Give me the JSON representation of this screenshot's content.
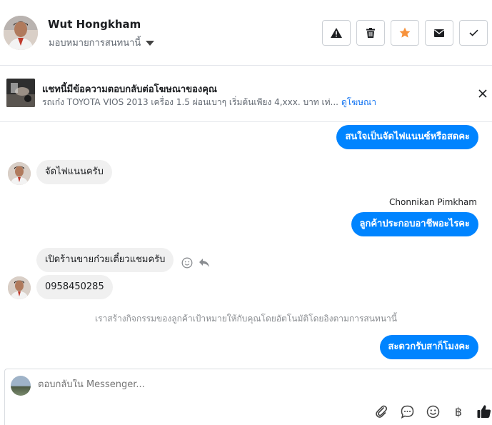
{
  "header": {
    "contact_name": "Wut Hongkham",
    "assign_label": "มอบหมายการสนทนานี้",
    "actions": [
      {
        "name": "report-button",
        "icon": "warning-icon"
      },
      {
        "name": "delete-button",
        "icon": "trash-icon"
      },
      {
        "name": "star-button",
        "icon": "star-icon"
      },
      {
        "name": "mark-unread-button",
        "icon": "envelope-icon"
      },
      {
        "name": "mark-done-button",
        "icon": "check-icon"
      }
    ],
    "star_color": "#f7923b"
  },
  "ad": {
    "title": "แชทนี้มีข้อความตอบกลับต่อโฆษณาของคุณ",
    "description": "รถเก๋ง TOYOTA VIOS 2013 เครื่อง 1.5 ผ่อนเบาๆ เริ่มต้นเพียง 4,xxx. บาท เท่...",
    "link_label": "ดูโฆษณา"
  },
  "messages": {
    "m1": "สนใจเป็นจัดไฟแนนซ์หรือสดคะ",
    "m2": "จัดไฟแนนครับ",
    "sender_name": "Chonnikan Pimkham",
    "m3": "ลูกค้าประกอบอาชีพอะไรคะ",
    "m4": "เปิดร้านขายก๋วยเตี๋ยวแชมครับ",
    "m5": "0958450285",
    "system": "เราสร้างกิจกรรมของลูกค้าเป้าหมายให้กับคุณโดยอัตโนมัติโดยอิงตามการสนทนานี้",
    "m6": "สะดวกรับสาก็โมงคะ"
  },
  "composer": {
    "placeholder": "ตอบกลับใน Messenger...",
    "currency_symbol": "฿"
  },
  "colors": {
    "outgoing_bubble": "#0084ff",
    "incoming_bubble": "#f0f0f0",
    "link": "#1877f2",
    "like": "#1877f2"
  }
}
